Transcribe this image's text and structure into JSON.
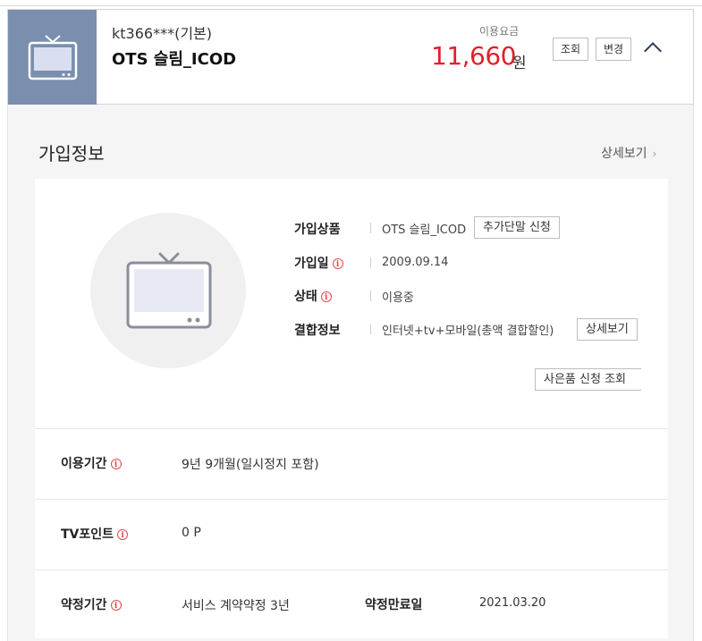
{
  "header": {
    "account_id": "kt366***(기본)",
    "product_name": "OTS 슬림_ICOD",
    "fee_label": "이용요금",
    "fee_amount": "11,660",
    "fee_unit": "원",
    "inquiry_button": "조회",
    "change_button": "변경",
    "icon": "tv-icon",
    "toggle_icon": "chevron-up-icon"
  },
  "section": {
    "title": "가입정보",
    "detail_link": "상세보기",
    "detail_arrow": "›"
  },
  "subscription": {
    "product_label": "가입상품",
    "product_value": "OTS 슬림_ICOD",
    "add_device_button": "추가단말 신청",
    "join_date_label": "가입일",
    "join_date_value": "2009.09.14",
    "status_label": "상태",
    "status_value": "이용중",
    "bundle_label": "결합정보",
    "bundle_value": "인터넷+tv+모바일(총액 결합할인)",
    "bundle_detail_button": "상세보기",
    "gift_inquiry_button": "사은품 신청 조회",
    "info_icon_glyph": "i"
  },
  "rows": {
    "usage_period_label": "이용기간",
    "usage_period_value": "9년 9개월(일시정지 포함)",
    "tv_point_label": "TV포인트",
    "tv_point_value": "0 P",
    "contract_period_label": "약정기간",
    "contract_period_value": "서비스 계약약정 3년",
    "contract_end_label": "약정만료일",
    "contract_end_value": "2021.03.20"
  },
  "colors": {
    "accent_red": "#e0202b",
    "icon_box": "#7a8fae"
  }
}
